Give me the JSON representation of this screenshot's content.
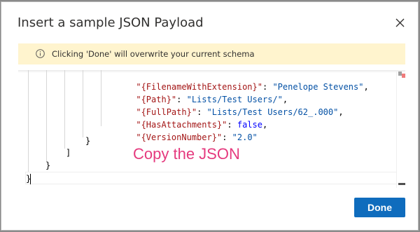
{
  "dialog": {
    "title": "Insert a sample JSON Payload",
    "close_icon": "close-icon",
    "banner": {
      "icon": "info-icon",
      "text": "Clicking 'Done' will overwrite your current schema",
      "background": "#fff4ce"
    },
    "editor": {
      "lines": [
        {
          "key": "\"{FilenameWithExtension}\"",
          "sep": ": ",
          "value": "\"Penelope Stevens\"",
          "value_type": "string",
          "trail": ","
        },
        {
          "key": "\"{Path}\"",
          "sep": ": ",
          "value": "\"Lists/Test Users/\"",
          "value_type": "string",
          "trail": ","
        },
        {
          "key": "\"{FullPath}\"",
          "sep": ": ",
          "value": "\"Lists/Test Users/62_.000\"",
          "value_type": "string",
          "trail": ","
        },
        {
          "key": "\"{HasAttachments}\"",
          "sep": ": ",
          "value": "false",
          "value_type": "keyword",
          "trail": ","
        },
        {
          "key": "\"{VersionNumber}\"",
          "sep": ": ",
          "value": "\"2.0\"",
          "value_type": "string",
          "trail": ""
        }
      ],
      "closing_brace_1": "}",
      "closing_bracket": "]",
      "closing_brace_2": "}",
      "closing_brace_3": "}"
    },
    "annotation": {
      "text": "Copy the JSON",
      "color": "#e53a7e"
    },
    "done_label": "Done",
    "accent": "#0f6cbd"
  }
}
